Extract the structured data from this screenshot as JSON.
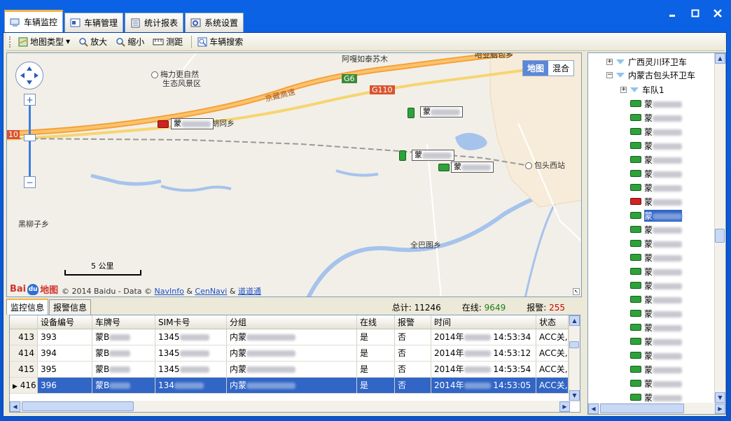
{
  "main_tabs": [
    {
      "label": "车辆监控",
      "icon": "monitor-icon",
      "active": true
    },
    {
      "label": "车辆管理",
      "icon": "vehicle-manage-icon",
      "active": false
    },
    {
      "label": "统计报表",
      "icon": "report-icon",
      "active": false
    },
    {
      "label": "系统设置",
      "icon": "settings-icon",
      "active": false
    }
  ],
  "toolbar": {
    "map_type": "地图类型",
    "zoom_in": "放大",
    "zoom_out": "缩小",
    "measure": "测距",
    "vehicle_search": "车辆搜索"
  },
  "map": {
    "type_map": "地图",
    "type_hybrid": "混合",
    "labels": {
      "amu": "阿嘎如泰苏木",
      "hadeng": "哈业脑包乡",
      "meili": "梅力更自然",
      "meili2": "生态风景区",
      "expressway": "京藏高速",
      "g6": "G6",
      "g110": "G110",
      "hutong": "胡同乡",
      "heiliuzi": "黑柳子乡",
      "baotou_west": "包头西站",
      "quanbatu": "全巴图乡",
      "edge_10": "10"
    },
    "vehicle_prefix": "蒙",
    "scale_label": "5 公里",
    "copyright": "© 2014 Baidu - Data ©",
    "navinfo": "NavInfo",
    "cennavi": "CenNavi",
    "daodaotong": "道道通",
    "baidu_text": "地图"
  },
  "bottom": {
    "tab_monitor": "监控信息",
    "tab_alarm": "报警信息",
    "total_label": "总计:",
    "total_value": "11246",
    "online_label": "在线:",
    "online_value": "9649",
    "alarm_label": "报警:",
    "alarm_value": "255"
  },
  "grid": {
    "headers": [
      "设备编号",
      "车牌号",
      "SIM卡号",
      "分组",
      "在线",
      "报警",
      "时间",
      "状态"
    ],
    "rows": [
      {
        "idx": "413",
        "device": "393",
        "plate": "蒙B",
        "sim": "1345",
        "group": "内蒙",
        "online": "是",
        "alarm": "否",
        "date": "2014年",
        "time": "14:53:34",
        "status": "ACC关,目",
        "selected": false
      },
      {
        "idx": "414",
        "device": "394",
        "plate": "蒙B",
        "sim": "1345",
        "group": "内蒙",
        "online": "是",
        "alarm": "否",
        "date": "2014年",
        "time": "14:53:12",
        "status": "ACC关,目",
        "selected": false
      },
      {
        "idx": "415",
        "device": "395",
        "plate": "蒙B",
        "sim": "1345",
        "group": "内蒙",
        "online": "是",
        "alarm": "否",
        "date": "2014年",
        "time": "14:53:54",
        "status": "ACC关,目",
        "selected": false
      },
      {
        "idx": "416",
        "device": "396",
        "plate": "蒙B",
        "sim": "134",
        "group": "内蒙",
        "online": "是",
        "alarm": "否",
        "date": "2014年",
        "time": "14:53:05",
        "status": "ACC关,目",
        "selected": true
      }
    ]
  },
  "tree": {
    "group1": "广西灵川环卫车",
    "group2": "内蒙古包头环卫车",
    "fleet": "车队1",
    "vehicle_prefix": "蒙",
    "vehicles": [
      "g",
      "g",
      "g",
      "g",
      "g",
      "g",
      "g",
      "r",
      "s",
      "g",
      "g",
      "g",
      "g",
      "g",
      "g",
      "g",
      "g",
      "g",
      "g",
      "g",
      "g",
      "g"
    ]
  },
  "colors": {
    "title_bar": "#0a5ad6",
    "selection": "#3165c6",
    "online_green": "#1e7a1e",
    "alarm_red": "#cc0000",
    "tab_accent": "#f5b244"
  }
}
